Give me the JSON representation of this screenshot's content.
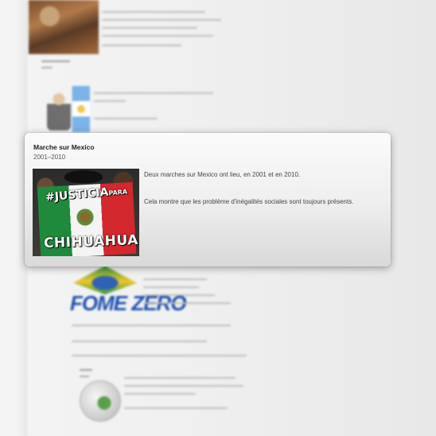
{
  "popup": {
    "title": "Marche sur Mexico",
    "date": "2001–2010",
    "paragraphs": [
      "Deux marches sur Mexico ont lieu, en 2001 et en 2010.",
      "Cela montre que les problème d'inégalités sociales sont toujours présents."
    ],
    "image_sign_top": "#JUSTICIA",
    "image_sign_top_small": "PARA",
    "image_sign_bottom": "CHIHUAHUA"
  },
  "background": {
    "logo_text": "FOME ZERO"
  }
}
